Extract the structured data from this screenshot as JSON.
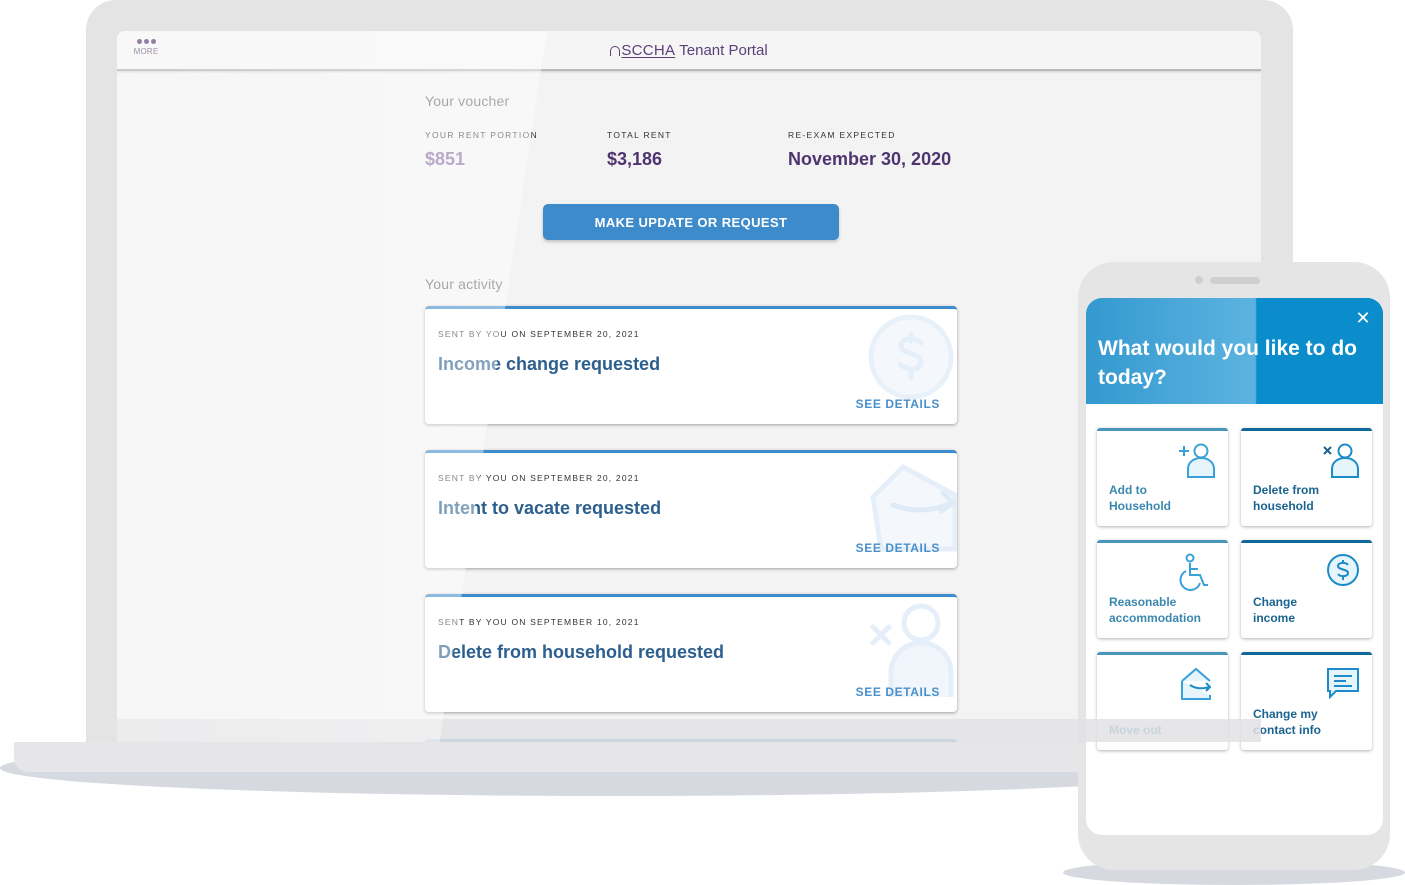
{
  "portal": {
    "more_label": "MORE",
    "brand_logo": "SCCHA",
    "brand_title": "Tenant Portal"
  },
  "voucher": {
    "title": "Your voucher",
    "stats": [
      {
        "label": "YOUR RENT PORTION",
        "value": "$851",
        "color": "#8a6fa6"
      },
      {
        "label": "TOTAL RENT",
        "value": "$3,186",
        "color": "#4f3570"
      },
      {
        "label": "RE-EXAM EXPECTED",
        "value": "November 30, 2020",
        "color": "#4f3570"
      }
    ],
    "primary_button": "MAKE UPDATE OR REQUEST"
  },
  "activity": {
    "title": "Your activity",
    "items": [
      {
        "meta": "SENT BY YOU ON SEPTEMBER 20, 2021",
        "title": "Income change requested",
        "link": "SEE DETAILS",
        "icon": "dollar-circle-icon"
      },
      {
        "meta": "SENT BY YOU ON SEPTEMBER 20, 2021",
        "title": "Intent to vacate requested",
        "link": "SEE DETAILS",
        "icon": "move-out-house-icon"
      },
      {
        "meta": "SENT BY YOU ON SEPTEMBER 10, 2021",
        "title": "Delete from household requested",
        "link": "SEE DETAILS",
        "icon": "delete-person-icon"
      }
    ]
  },
  "mobile": {
    "title": "What would you like to do today?",
    "close_icon": "close-icon",
    "close_glyph": "✕",
    "tiles": [
      {
        "label_line1": "Add to",
        "label_line2": "Household",
        "icon": "add-person-icon"
      },
      {
        "label_line1": "Delete from",
        "label_line2": "household",
        "icon": "delete-person-icon"
      },
      {
        "label_line1": "Reasonable",
        "label_line2": "accommodation",
        "icon": "wheelchair-icon"
      },
      {
        "label_line1": "Change",
        "label_line2": "income",
        "icon": "dollar-circle-icon"
      },
      {
        "label_line1": "",
        "label_line2": "Move out",
        "icon": "move-out-house-icon"
      },
      {
        "label_line1": "Change my",
        "label_line2": "contact info",
        "icon": "chat-message-icon"
      }
    ]
  },
  "colors": {
    "primary_blue": "#3e8bcb",
    "brand_purple": "#5b3f78",
    "header_blue": "#0b8dcc",
    "title_blue": "#2c5f8e"
  }
}
